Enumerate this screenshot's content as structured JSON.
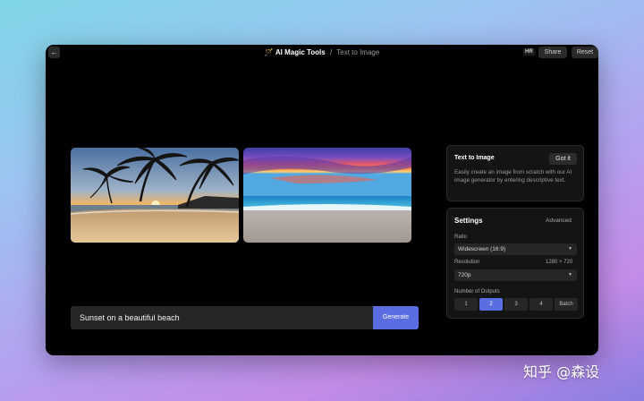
{
  "topbar": {
    "back_icon": "arrow-left-icon",
    "app_icon": "magic-wand-icon",
    "app_name": "AI Magic Tools",
    "separator": "/",
    "page_name": "Text to Image",
    "hr_badge": "HR",
    "share_label": "Share",
    "reset_label": "Reset"
  },
  "images": [
    {
      "alt": "palm-beach-sunset"
    },
    {
      "alt": "ocean-sunset"
    }
  ],
  "prompt": {
    "value": "Sunset on a beautiful beach",
    "generate_label": "Generate"
  },
  "info_panel": {
    "title": "Text to Image",
    "got_it_label": "Got it",
    "description": "Easily create an image from scratch with our AI image generator by entering descriptive text."
  },
  "settings": {
    "title": "Settings",
    "advanced_label": "Advanced",
    "ratio_label": "Ratio",
    "ratio_value": "Widescreen (16:9)",
    "resolution_label": "Resolution",
    "resolution_dims": "1280 × 720",
    "resolution_value": "720p",
    "outputs_label": "Number of Outputs",
    "outputs": [
      "1",
      "2",
      "3",
      "4",
      "Batch"
    ],
    "selected_output": "2"
  },
  "watermark": "知乎 @森设",
  "colors": {
    "accent": "#5b6ee1",
    "window_bg": "#000000",
    "panel_bg": "#141414"
  }
}
